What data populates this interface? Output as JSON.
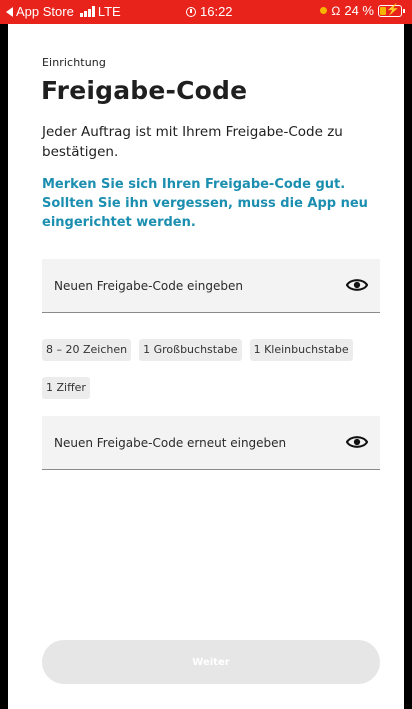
{
  "status_bar": {
    "back_app": "App Store",
    "network": "LTE",
    "time": "16:22",
    "battery": "24 %",
    "background_color": "#e8231c"
  },
  "page": {
    "eyebrow": "Einrichtung",
    "title": "Freigabe-Code",
    "description": "Jeder Auftrag ist mit Ihrem Freigabe-Code zu bestätigen.",
    "hint": "Merken Sie sich Ihren Freigabe-Code gut. Sollten Sie ihn vergessen, muss die App neu eingerichtet werden.",
    "hint_color": "#1c8fb0"
  },
  "fields": {
    "new_code": {
      "label": "Neuen Freigabe-Code eingeben",
      "icon": "eye-icon"
    },
    "repeat_code": {
      "label": "Neuen Freigabe-Code erneut eingeben",
      "icon": "eye-icon"
    }
  },
  "requirements": [
    "8 – 20 Zeichen",
    "1 Großbuchstabe",
    "1 Kleinbuchstabe",
    "1 Ziffer"
  ],
  "submit": {
    "label": "Weiter",
    "enabled": false
  }
}
